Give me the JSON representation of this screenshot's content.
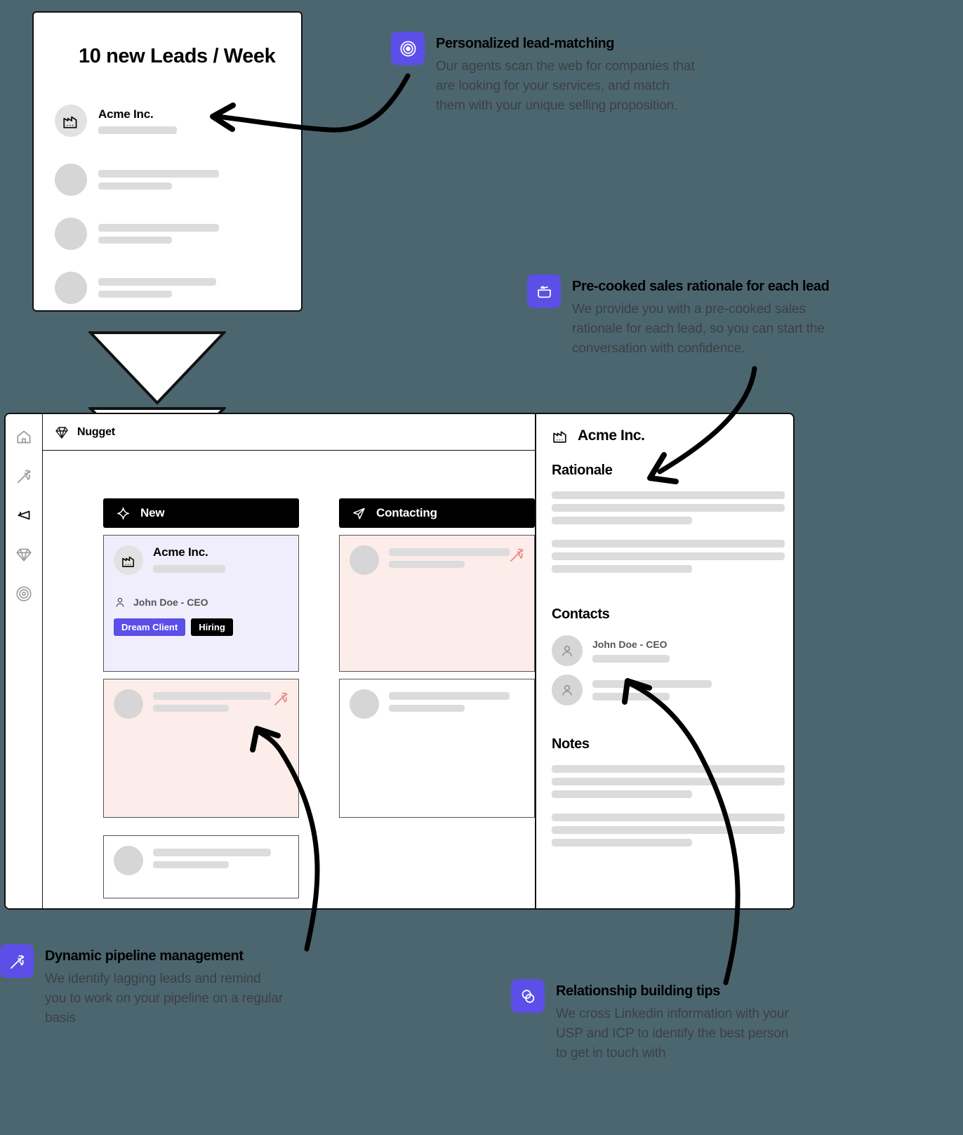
{
  "background_color": "#4c6670",
  "accent_color": "#5b4fe8",
  "lead_card": {
    "title": "10 new Leads / Week",
    "first_lead_name": "Acme Inc.",
    "first_lead_icon": "factory-icon",
    "placeholder_rows": 3
  },
  "flow_arrow": {
    "icon": "double-chevron-down-icon"
  },
  "app": {
    "brand": "Nugget",
    "brand_icon": "gem-icon",
    "sidebar": [
      {
        "name": "sidebar-item-home",
        "icon": "home-icon"
      },
      {
        "name": "sidebar-item-mining",
        "icon": "pickaxe-icon"
      },
      {
        "name": "sidebar-item-campaign",
        "icon": "send-icon"
      },
      {
        "name": "sidebar-item-gems",
        "icon": "diamond-icon"
      },
      {
        "name": "sidebar-item-targets",
        "icon": "target-icon"
      }
    ],
    "columns": [
      {
        "id": "new",
        "label": "New",
        "icon": "sparkle-icon",
        "cards": [
          {
            "style": "purple",
            "company": "Acme Inc.",
            "company_icon": "factory-icon",
            "contact": "John Doe - CEO",
            "contact_icon": "person-icon",
            "tags": [
              {
                "label": "Dream Client",
                "style": "primary"
              },
              {
                "label": "Hiring",
                "style": "dark"
              }
            ]
          },
          {
            "style": "pink",
            "company": "",
            "contact": "",
            "tags": [],
            "flag_icon": "hammer-icon"
          },
          {
            "style": "plain",
            "company": "",
            "contact": "",
            "tags": []
          }
        ]
      },
      {
        "id": "contacting",
        "label": "Contacting",
        "icon": "send-icon",
        "cards": [
          {
            "style": "pink",
            "company": "",
            "contact": "",
            "tags": [],
            "flag_icon": "hammer-icon"
          },
          {
            "style": "plain",
            "company": "",
            "contact": "",
            "tags": []
          }
        ]
      }
    ],
    "detail": {
      "company": "Acme Inc.",
      "company_icon": "factory-icon",
      "sections": [
        {
          "id": "rationale",
          "title": "Rationale"
        },
        {
          "id": "contacts",
          "title": "Contacts"
        },
        {
          "id": "notes",
          "title": "Notes"
        }
      ],
      "contacts": [
        {
          "name": "John Doe - CEO",
          "icon": "person-icon"
        },
        {
          "name": "",
          "icon": "person-icon"
        }
      ]
    }
  },
  "annotations": [
    {
      "id": "personalized-lead-matching",
      "icon": "target-icon",
      "title": "Personalized lead-matching",
      "body": "Our agents scan the web for companies that\nare looking for your services, and match\nthem with your unique selling proposition."
    },
    {
      "id": "pre-cooked-sales-rationale",
      "icon": "cooking-pot-icon",
      "title": "Pre-cooked sales rationale for each lead",
      "body": "We provide you with a pre-cooked sales\nrationale for each lead, so you can start the\nconversation with confidence."
    },
    {
      "id": "dynamic-pipeline-management",
      "icon": "hammer-icon",
      "title": "Dynamic pipeline management",
      "body": "We identify lagging leads and remind\nyou to work on your pipeline on a regular\nbasis"
    },
    {
      "id": "relationship-building-tips",
      "icon": "venn-icon",
      "title": "Relationship building tips",
      "body": "We cross Linkedin information with your\nUSP and ICP to identify the best person\nto get in touch with"
    }
  ]
}
